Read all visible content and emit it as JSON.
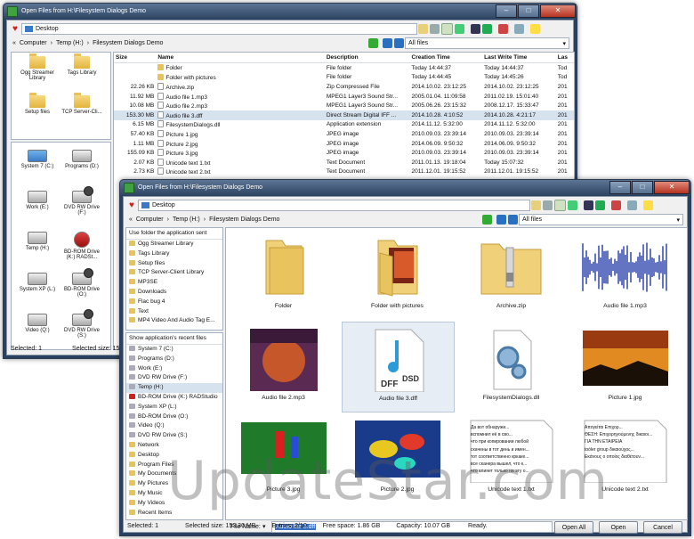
{
  "back": {
    "title": "Open Files from H:\\Filesystem Dialogs Demo",
    "address": "Desktop",
    "breadcrumb": [
      "Computer",
      "Temp (H:)",
      "Filesystem Dialogs Demo"
    ],
    "filter": "All files",
    "favorites": [
      {
        "label": "Ogg Streamer Library",
        "icon": "folder-icon"
      },
      {
        "label": "Tags Library",
        "icon": "folder-icon"
      },
      {
        "label": "Setup files",
        "icon": "folder-icon"
      },
      {
        "label": "TCP Server-Cli...",
        "icon": "folder-icon"
      }
    ],
    "drives": [
      {
        "label": "System 7 (C:)",
        "icon": "windows-drive-icon"
      },
      {
        "label": "Programs (D:)",
        "icon": "hard-drive-icon"
      },
      {
        "label": "Work (E:)",
        "icon": "hard-drive-icon"
      },
      {
        "label": "DVD RW Drive (F:)",
        "icon": "dvd-drive-icon"
      },
      {
        "label": "Temp (H:)",
        "icon": "hard-drive-icon"
      },
      {
        "label": "BD-ROM Drive (K:) RADSt...",
        "icon": "bd-drive-icon"
      },
      {
        "label": "System XP (L:)",
        "icon": "hard-drive-icon"
      },
      {
        "label": "BD-ROM Drive (O:)",
        "icon": "dvd-drive-icon"
      },
      {
        "label": "Video (Q:)",
        "icon": "hard-drive-icon"
      },
      {
        "label": "DVD RW Drive (S:)",
        "icon": "dvd-drive-icon"
      }
    ],
    "columns": [
      "Size",
      "Name",
      "Description",
      "Creation Time",
      "Last Write Time",
      "Las"
    ],
    "rows": [
      {
        "size": "",
        "name": "Folder",
        "desc": "File folder",
        "created": "Today 14:44:37",
        "written": "Today 14:44:37",
        "last": "Tod",
        "type": "folder"
      },
      {
        "size": "",
        "name": "Folder with pictures",
        "desc": "File folder",
        "created": "Today 14:44:45",
        "written": "Today 14:45:26",
        "last": "Tod",
        "type": "folder"
      },
      {
        "size": "22.26 KB",
        "name": "Archive.zip",
        "desc": "Zip Compressed File",
        "created": "2014.10.02. 23:12:25",
        "written": "2014.10.02. 23:12:25",
        "last": "201",
        "type": "file"
      },
      {
        "size": "11.92 MB",
        "name": "Audio file 1.mp3",
        "desc": "MPEG1 Layer3 Sound Str...",
        "created": "2005.01.04. 11:09:58",
        "written": "2011.02.19. 15:01:40",
        "last": "201",
        "type": "file"
      },
      {
        "size": "10.08 MB",
        "name": "Audio file 2.mp3",
        "desc": "MPEG1 Layer3 Sound Str...",
        "created": "2005.06.26. 23:15:32",
        "written": "2008.12.17. 15:33:47",
        "last": "201",
        "type": "file"
      },
      {
        "size": "153.30 MB",
        "name": "Audio file 3.dff",
        "desc": "Direct Stream Digital IFF ...",
        "created": "2014.10.28. 4:10:52",
        "written": "2014.10.28. 4:21:17",
        "last": "201",
        "type": "file"
      },
      {
        "size": "6.15 MB",
        "name": "FilesystemDialogs.dll",
        "desc": "Application extension",
        "created": "2014.11.12. 5:32:00",
        "written": "2014.11.12. 5:32:00",
        "last": "201",
        "type": "file"
      },
      {
        "size": "57.40 KB",
        "name": "Picture 1.jpg",
        "desc": "JPEG image",
        "created": "2010.09.03. 23:39:14",
        "written": "2010.09.03. 23:39:14",
        "last": "201",
        "type": "file"
      },
      {
        "size": "1.11 MB",
        "name": "Picture 2.jpg",
        "desc": "JPEG image",
        "created": "2014.06.09. 9:50:32",
        "written": "2014.06.09. 9:50:32",
        "last": "201",
        "type": "file"
      },
      {
        "size": "155.09 KB",
        "name": "Picture 3.jpg",
        "desc": "JPEG image",
        "created": "2010.09.03. 23:39:14",
        "written": "2010.09.03. 23:39:14",
        "last": "201",
        "type": "file"
      },
      {
        "size": "2.07 KB",
        "name": "Unicode text 1.txt",
        "desc": "Text Document",
        "created": "2011.01.13. 19:18:04",
        "written": "Today 15:07:32",
        "last": "201",
        "type": "file"
      },
      {
        "size": "2.73 KB",
        "name": "Unicode text 2.txt",
        "desc": "Text Document",
        "created": "2011.12.01. 19:15:52",
        "written": "2011.12.01. 19:15:52",
        "last": "201",
        "type": "file"
      }
    ],
    "status_selected": "Selected: 1",
    "status_size": "Selected size: 15"
  },
  "front": {
    "title": "Open Files from H:\\Filesystem Dialogs Demo",
    "address": "Desktop",
    "breadcrumb": [
      "Computer",
      "Temp (H:)",
      "Filesystem Dialogs Demo"
    ],
    "filter": "All files",
    "sent_header": "Use folder the application sent",
    "sent_items": [
      "Ogg Streamer Library",
      "Tags Library",
      "Setup files",
      "TCP Server-Client Library",
      "MP3SE",
      "Downloads",
      "Flac bug 4",
      "Text",
      "MP4 Video And Audio Tag E..."
    ],
    "recent_header": "Show application's recent files",
    "recent_items": [
      "System 7 (C:)",
      "Programs (D:)",
      "Work (E:)",
      "DVD RW Drive (F:)",
      "Temp (H:)",
      "BD-ROM Drive (K:) RADStudio",
      "System XP (L:)",
      "BD-ROM Drive (O:)",
      "Video (Q:)",
      "DVD RW Drive (S:)",
      "Network",
      "Desktop",
      "Program Files",
      "My Documents",
      "My Pictures",
      "My Music",
      "My Videos",
      "Recent Items"
    ],
    "tiles": [
      {
        "caption": "Folder",
        "kind": "folder"
      },
      {
        "caption": "Folder with pictures",
        "kind": "folder-pictures"
      },
      {
        "caption": "Archive.zip",
        "kind": "zip"
      },
      {
        "caption": "Audio file 1.mp3",
        "kind": "waveform"
      },
      {
        "caption": "Audio file 2.mp3",
        "kind": "album-art"
      },
      {
        "caption": "Audio file 3.dff",
        "kind": "dff",
        "badge": "DFF",
        "badge2": "DSD"
      },
      {
        "caption": "FilesystemDialogs.dll",
        "kind": "dll"
      },
      {
        "caption": "Picture 1.jpg",
        "kind": "sunset"
      },
      {
        "caption": "Picture 3.jpg",
        "kind": "parrots"
      },
      {
        "caption": "Picture 2.jpg",
        "kind": "fish"
      },
      {
        "caption": "Unicode text 1.txt",
        "kind": "text",
        "lines": [
          "Да вот обнаружи...",
          "вспомнил её в сво...",
          "что при копировании любой",
          "скачены в тот день и имен...",
          "тот соответственно кркаке...",
          "все сканера вышел, что к...",
          "что влияет только на эту о..."
        ]
      },
      {
        "caption": "Unicode text 2.txt",
        "kind": "text",
        "lines": [
          "Απογείται Επιχορ...",
          "",
          "ΘΕΣΗ: Επιχορηγούμενης δικαιοι...",
          "",
          "ΓΙΑ ΤΗΝ ΕΤΑΙΡΕΙΑ",
          "toóler group δικαιούχος...",
          "Εκάνους ο οποίος διαθέτουν..."
        ]
      }
    ],
    "file_name_label": "File Name:",
    "file_name_value": "Audio file 3.dff",
    "open_all": "Open All",
    "open": "Open",
    "cancel": "Cancel",
    "status": {
      "selected": "Selected: 1",
      "size": "Selected size: 153.30 MB",
      "entries": "Entries: 2/10",
      "free": "Free space: 1.86 GB",
      "capacity": "Capacity: 10.07 GB",
      "ready": "Ready."
    }
  },
  "watermark": "UpdateStar.com"
}
